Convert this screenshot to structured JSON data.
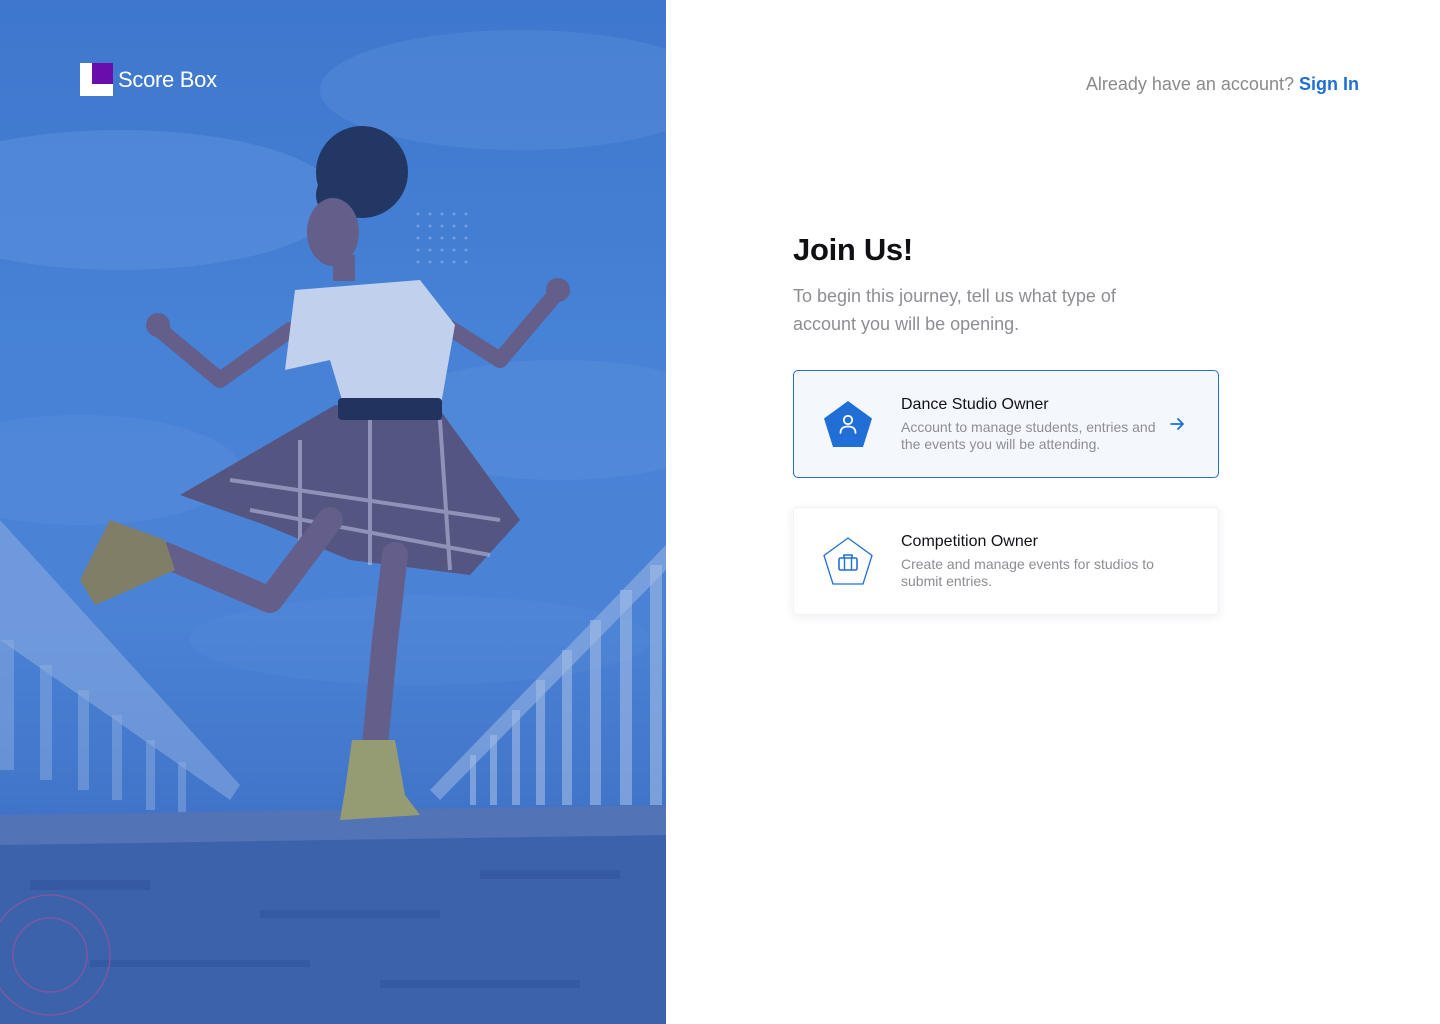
{
  "brand": {
    "name": "Score Box",
    "accent": "#6a0dad"
  },
  "header": {
    "prompt": "Already have an account?",
    "signin_link": "Sign In"
  },
  "main": {
    "title": "Join Us!",
    "subtitle": "To begin this journey, tell us what type of account you will be opening."
  },
  "options": [
    {
      "title": "Dance Studio Owner",
      "description": "Account to manage students, entries and the events you will be attending.",
      "icon": "user-icon",
      "selected": true
    },
    {
      "title": "Competition Owner",
      "description": "Create and manage events for studios to submit entries.",
      "icon": "briefcase-icon",
      "selected": false
    }
  ],
  "colors": {
    "primary": "#1f6fd6",
    "hero_overlay": "#4a86d8",
    "muted_text": "#8d8d93"
  }
}
